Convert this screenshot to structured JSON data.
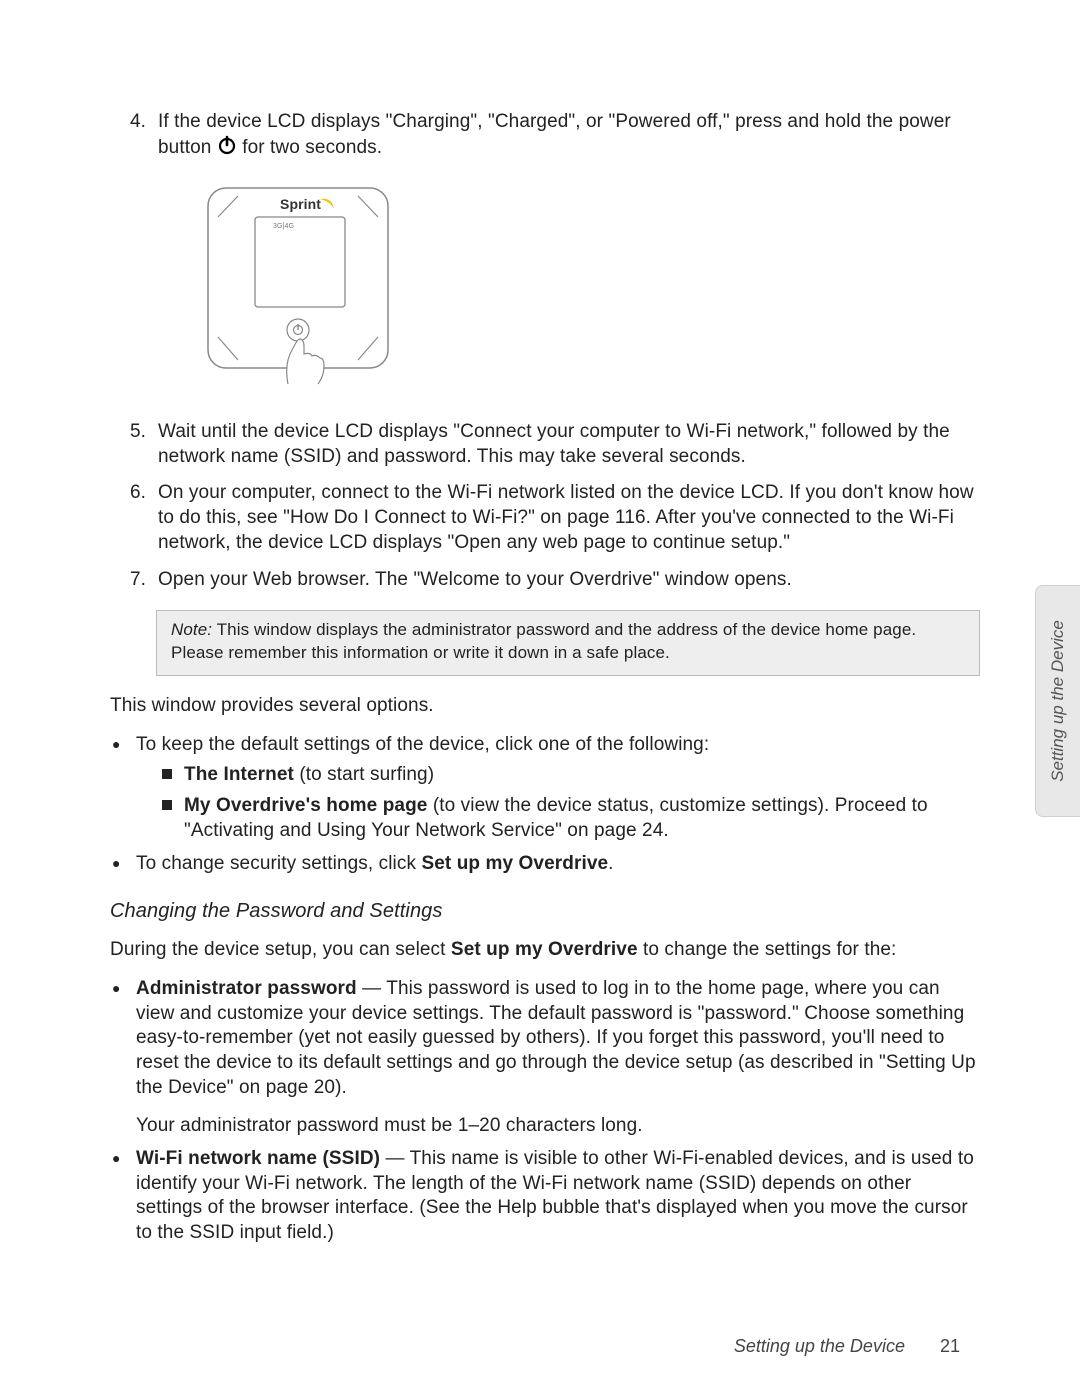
{
  "steps": {
    "s4": {
      "num": "4.",
      "pre": "If the device LCD displays \"Charging\", \"Charged\", or \"Powered off,\" press and hold the power button ",
      "post": " for two seconds."
    },
    "s5": {
      "num": "5.",
      "text": "Wait until the device LCD displays \"Connect your computer to Wi-Fi network,\" followed by the network name (SSID) and password. This may take several seconds."
    },
    "s6": {
      "num": "6.",
      "text": "On your computer, connect to the Wi-Fi network listed on the device LCD. If you don't know how to do this, see \"How Do I Connect to Wi-Fi?\" on page 116. After you've connected to the Wi-Fi network, the device LCD displays \"Open any web page to continue setup.\""
    },
    "s7": {
      "num": "7.",
      "text": "Open your Web browser. The \"Welcome to your Overdrive\" window opens."
    }
  },
  "device_figure": {
    "brand": "Sprint",
    "screen_text": "3G|4G"
  },
  "note": {
    "label": "Note:",
    "text": " This window displays the administrator password and the address of the device home page. Please remember this information or write it down in a safe place."
  },
  "after_note_para": "This window provides several options.",
  "options": {
    "keep_default": "To keep the default settings of the device, click one of the following:",
    "internet_bold": "The Internet",
    "internet_rest": " (to start surfing)",
    "home_bold": "My Overdrive's home page",
    "home_rest": " (to view the device status, customize settings). Proceed to \"Activating and Using Your Network Service\" on page 24.",
    "security_pre": "To change security settings, click ",
    "security_bold": "Set up my Overdrive",
    "security_post": "."
  },
  "subhead": "Changing the Password and Settings",
  "setup_intro_pre": "During the device setup, you can select ",
  "setup_intro_bold": "Set up my Overdrive",
  "setup_intro_post": " to change the settings for the:",
  "admin_pw": {
    "bold": "Administrator password",
    "rest": " — This password is used to log in to the home page, where you can view and customize your device settings. The default password is \"password.\" Choose something easy-to-remember (yet not easily guessed by others). If you forget this password, you'll need to reset the device to its default settings and go through the device setup (as described in \"Setting Up the Device\" on page 20).",
    "length": "Your administrator password must be 1–20 characters long."
  },
  "ssid": {
    "bold": "Wi-Fi network name (SSID)",
    "rest": " — This name is visible to other Wi-Fi-enabled devices, and is used to identify your Wi-Fi network. The length of the Wi-Fi network name (SSID) depends on other settings of the browser interface. (See the Help bubble that's displayed when you move the cursor to the SSID input field.)"
  },
  "side_tab": "Setting up the Device",
  "footer": {
    "chapter": "Setting up the Device",
    "page": "21"
  }
}
